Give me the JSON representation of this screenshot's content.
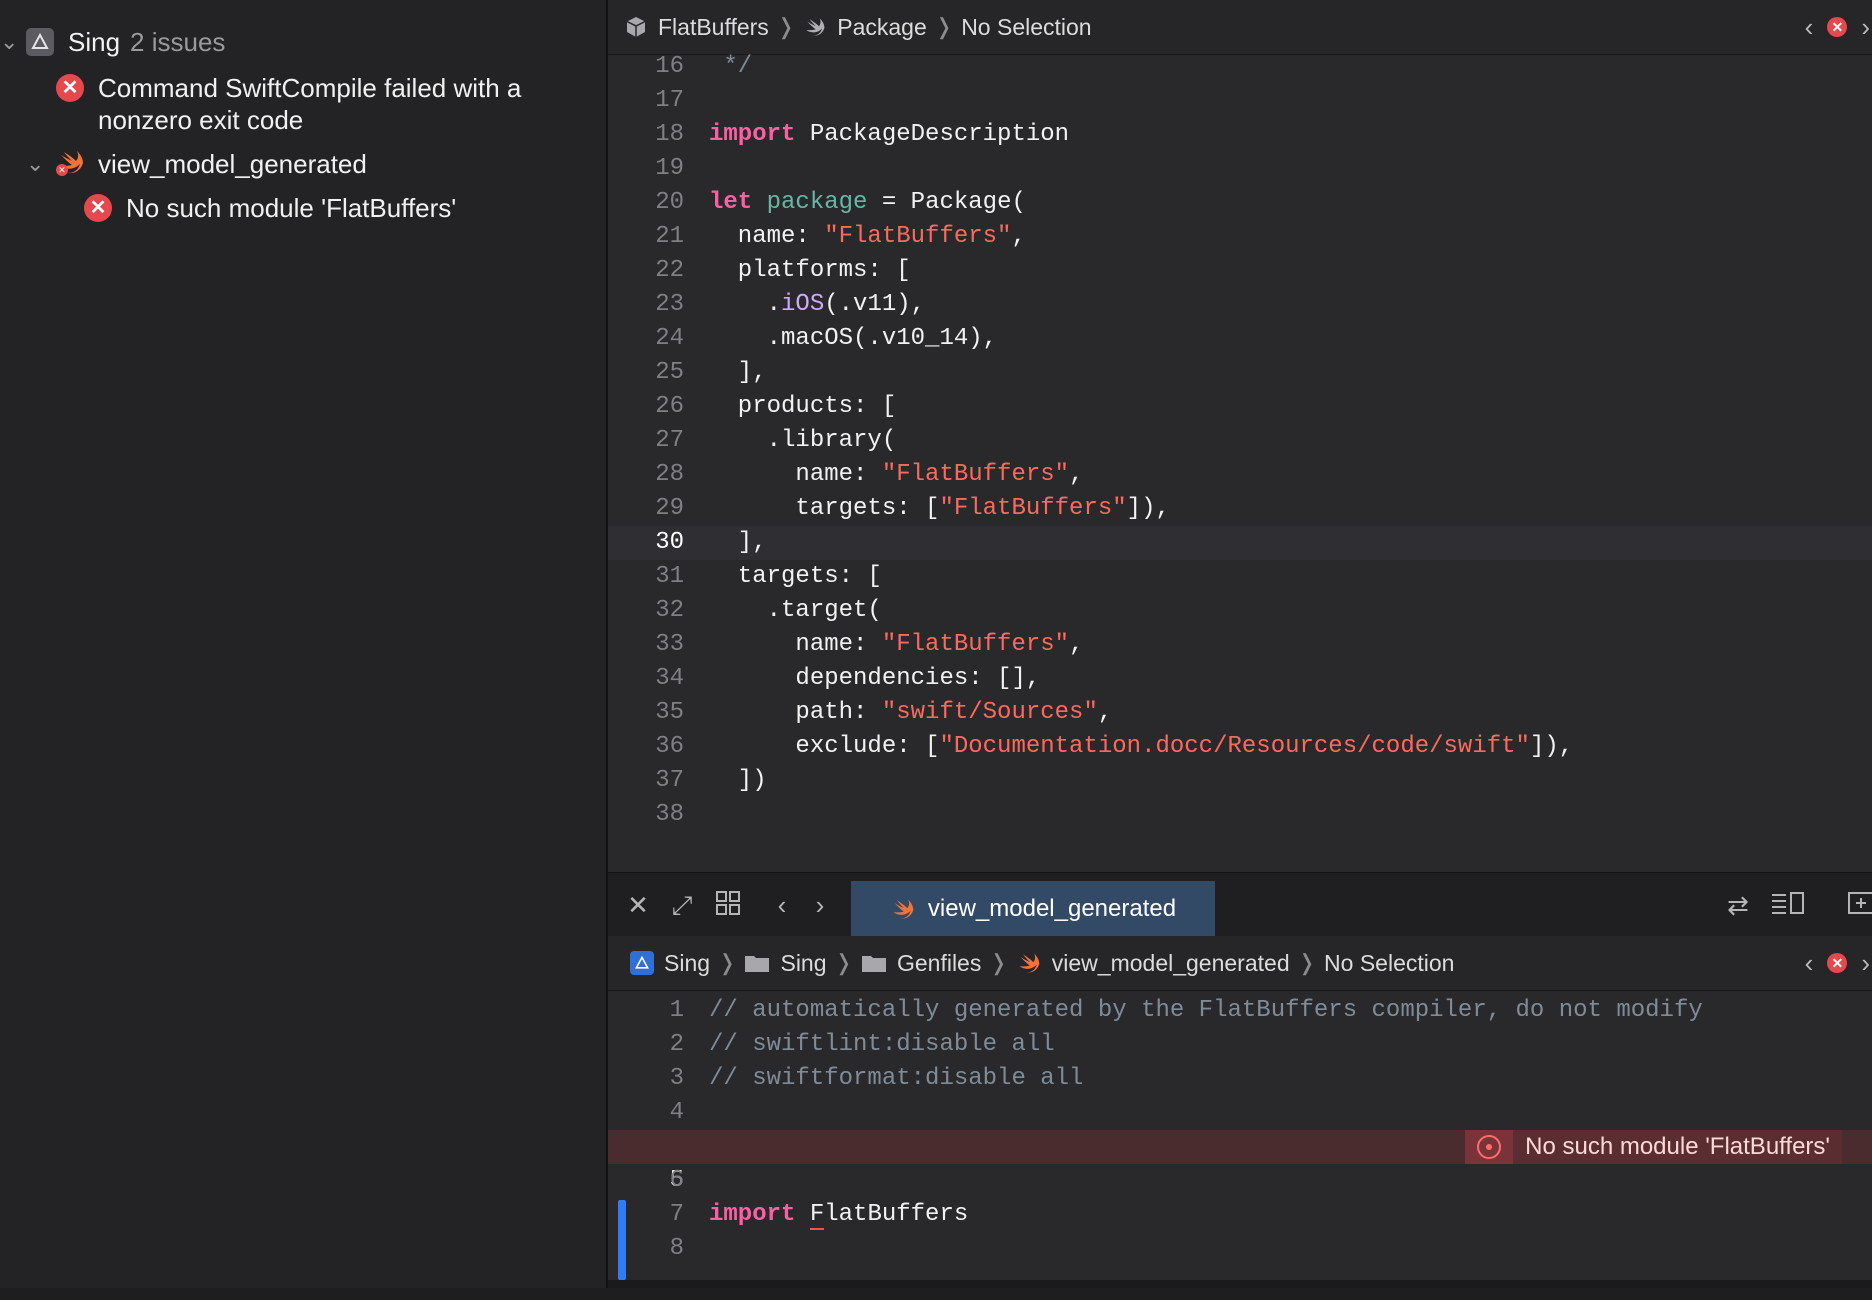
{
  "issues": {
    "project": "Sing",
    "count": "2 issues",
    "items": [
      {
        "text_line1": "Command SwiftCompile failed with a",
        "text_line2": "nonzero exit code"
      },
      {
        "group": "view_model_generated"
      },
      {
        "text": "No such module 'FlatBuffers'"
      }
    ]
  },
  "top_editor": {
    "breadcrumb": [
      "FlatBuffers",
      "Package",
      "No Selection"
    ],
    "lines": [
      {
        "n": "16",
        "t": " */"
      },
      {
        "n": "17",
        "t": ""
      },
      {
        "n": "18",
        "t": "import PackageDescription"
      },
      {
        "n": "19",
        "t": ""
      },
      {
        "n": "20",
        "t": "let package = Package("
      },
      {
        "n": "21",
        "t": "  name: \"FlatBuffers\","
      },
      {
        "n": "22",
        "t": "  platforms: ["
      },
      {
        "n": "23",
        "t": "    .iOS(.v11),"
      },
      {
        "n": "24",
        "t": "    .macOS(.v10_14),"
      },
      {
        "n": "25",
        "t": "  ],"
      },
      {
        "n": "26",
        "t": "  products: ["
      },
      {
        "n": "27",
        "t": "    .library("
      },
      {
        "n": "28",
        "t": "      name: \"FlatBuffers\","
      },
      {
        "n": "29",
        "t": "      targets: [\"FlatBuffers\"]),"
      },
      {
        "n": "30",
        "t": "  ],"
      },
      {
        "n": "31",
        "t": "  targets: ["
      },
      {
        "n": "32",
        "t": "    .target("
      },
      {
        "n": "33",
        "t": "      name: \"FlatBuffers\","
      },
      {
        "n": "34",
        "t": "      dependencies: [],"
      },
      {
        "n": "35",
        "t": "      path: \"swift/Sources\","
      },
      {
        "n": "36",
        "t": "      exclude: [\"Documentation.docc/Resources/code/swift\"]),"
      },
      {
        "n": "37",
        "t": "  ])"
      },
      {
        "n": "38",
        "t": ""
      }
    ]
  },
  "tab": {
    "label": "view_model_generated"
  },
  "bottom_editor": {
    "breadcrumb": [
      "Sing",
      "Sing",
      "Genfiles",
      "view_model_generated",
      "No Selection"
    ],
    "lines": [
      {
        "n": "1",
        "t": "// automatically generated by the FlatBuffers compiler, do not modify"
      },
      {
        "n": "2",
        "t": "// swiftlint:disable all"
      },
      {
        "n": "3",
        "t": "// swiftformat:disable all"
      },
      {
        "n": "4",
        "t": ""
      },
      {
        "n": "5",
        "t": "import FlatBuffers"
      },
      {
        "n": "6",
        "t": ""
      },
      {
        "n": "7",
        "t": ""
      },
      {
        "n": "8",
        "t": ""
      }
    ],
    "error_annotation": "No such module 'FlatBuffers'"
  },
  "colors": {
    "keyword": "#fc5fa3",
    "string": "#fc6a5d",
    "error": "#e5484d",
    "accent": "#2f7cf6"
  }
}
